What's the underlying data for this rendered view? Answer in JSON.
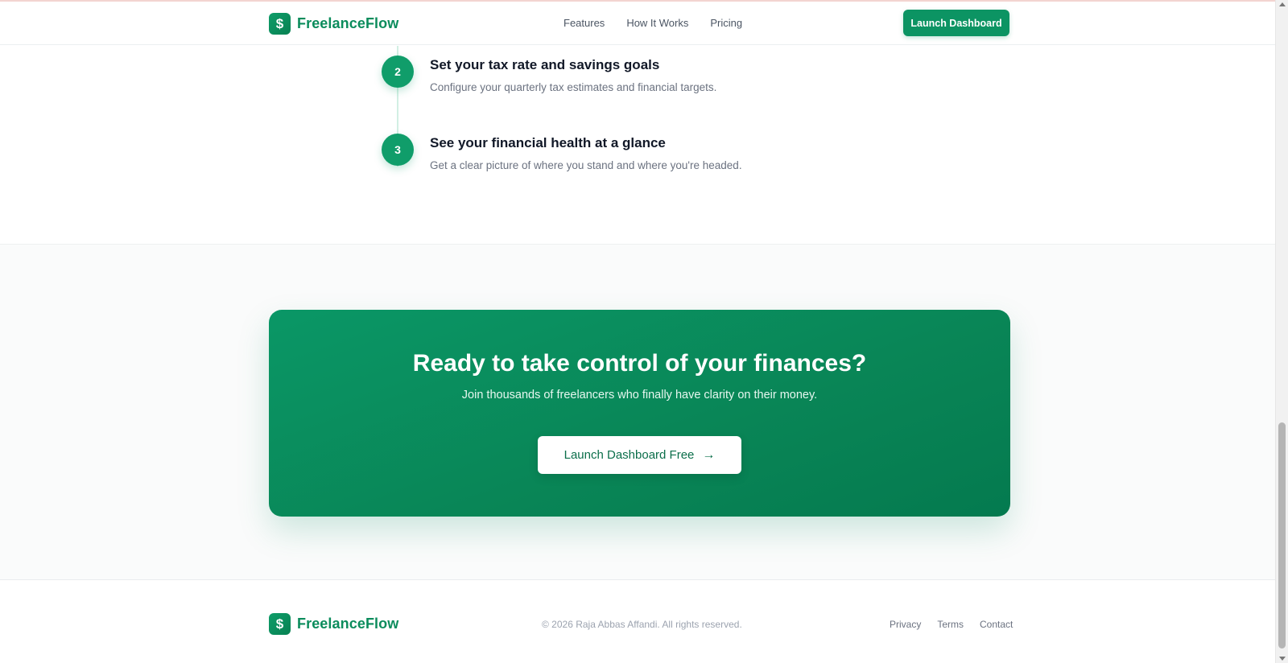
{
  "brand": {
    "name": "FreelanceFlow",
    "icon": "dollar-icon",
    "color": "#0b8c5c"
  },
  "nav": {
    "items": [
      {
        "label": "Features"
      },
      {
        "label": "How It Works"
      },
      {
        "label": "Pricing"
      }
    ],
    "cta_label": "Launch Dashboard"
  },
  "steps": [
    {
      "number": "2",
      "title": "Set your tax rate and savings goals",
      "description": "Configure your quarterly tax estimates and financial targets."
    },
    {
      "number": "3",
      "title": "See your financial health at a glance",
      "description": "Get a clear picture of where you stand and where you're headed."
    }
  ],
  "cta": {
    "title": "Ready to take control of your finances?",
    "subtitle": "Join thousands of freelancers who finally have clarity on their money.",
    "button_label": "Launch Dashboard Free",
    "button_icon": "arrow-right-icon"
  },
  "footer": {
    "copyright": "© 2026 Raja Abbas Affandi. All rights reserved.",
    "links": [
      {
        "label": "Privacy"
      },
      {
        "label": "Terms"
      },
      {
        "label": "Contact"
      }
    ]
  },
  "colors": {
    "accent": "#0c9463",
    "accent_dark": "#047a4f",
    "text": "#111827",
    "muted": "#6b7280"
  }
}
